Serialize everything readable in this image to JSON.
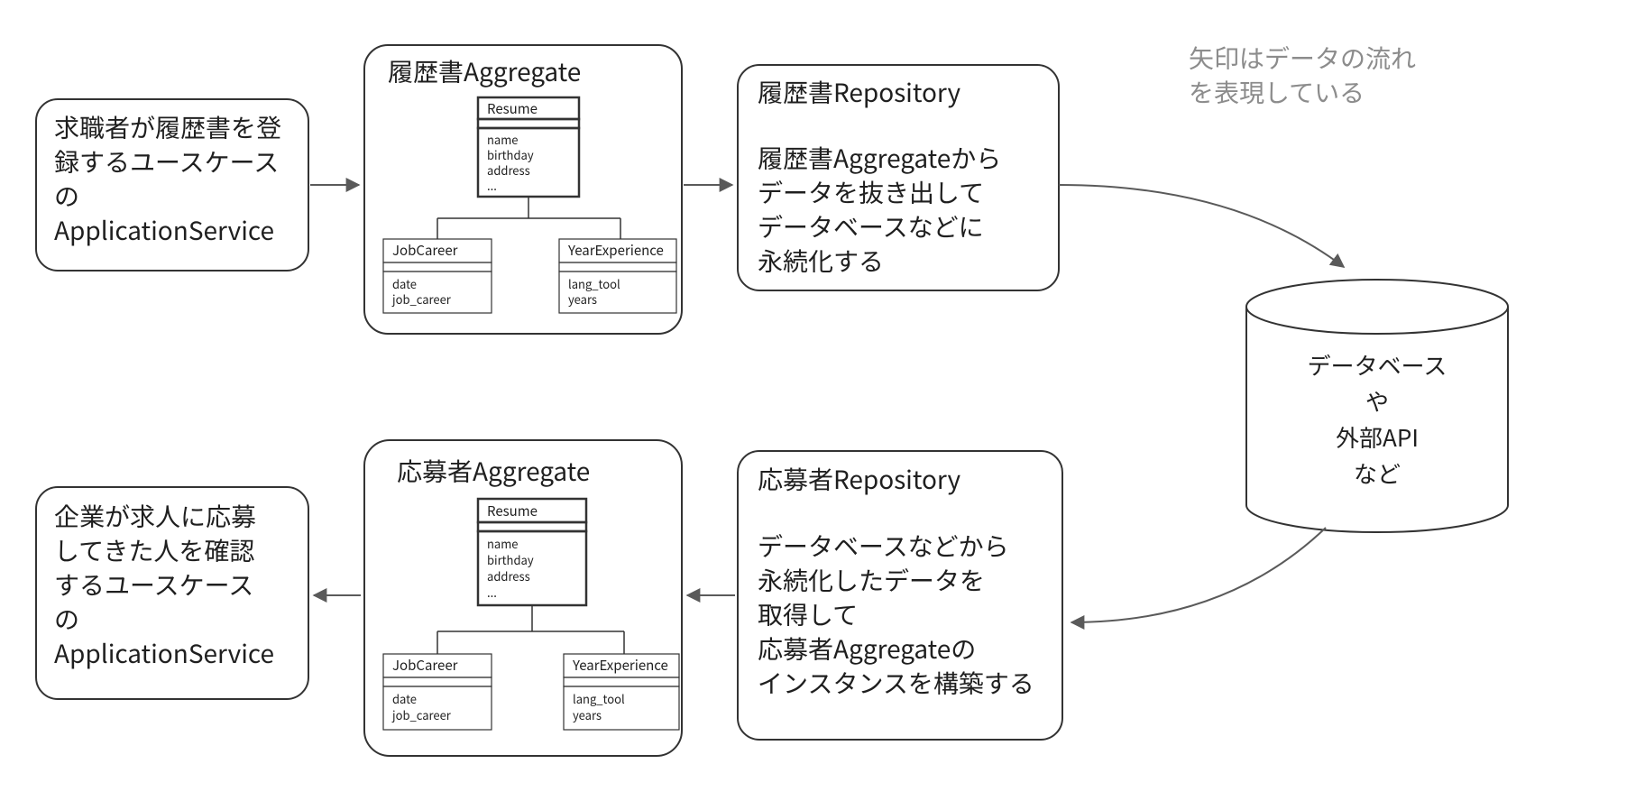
{
  "annotation": {
    "line1": "矢印はデータの流れ",
    "line2": "を表現している"
  },
  "top": {
    "appService": {
      "line1": "求職者が履歴書を登",
      "line2": "録するユースケース",
      "line3": "の",
      "line4": "ApplicationService"
    },
    "aggregate": {
      "title": "履歴書Aggregate",
      "root": {
        "name": "Resume",
        "attr1": "name",
        "attr2": "birthday",
        "attr3": "address",
        "attr4": "..."
      },
      "left": {
        "name": "JobCareer",
        "attr1": "date",
        "attr2": "job_career"
      },
      "right": {
        "name": "YearExperience",
        "attr1": "lang_tool",
        "attr2": "years"
      }
    },
    "repository": {
      "title": "履歴書Repository",
      "line1": "履歴書Aggregateから",
      "line2": "データを抜き出して",
      "line3": "データベースなどに",
      "line4": "永続化する"
    }
  },
  "bottom": {
    "appService": {
      "line1": "企業が求人に応募",
      "line2": "してきた人を確認",
      "line3": "するユースケース",
      "line4": "の",
      "line5": "ApplicationService"
    },
    "aggregate": {
      "title": "応募者Aggregate",
      "root": {
        "name": "Resume",
        "attr1": "name",
        "attr2": "birthday",
        "attr3": "address",
        "attr4": "..."
      },
      "left": {
        "name": "JobCareer",
        "attr1": "date",
        "attr2": "job_career"
      },
      "right": {
        "name": "YearExperience",
        "attr1": "lang_tool",
        "attr2": "years"
      }
    },
    "repository": {
      "title": "応募者Repository",
      "line1": "データベースなどから",
      "line2": "永続化したデータを",
      "line3": "取得して",
      "line4": "応募者Aggregateの",
      "line5": "インスタンスを構築する"
    }
  },
  "db": {
    "line1": "データベース",
    "line2": "や",
    "line3": "外部API",
    "line4": "など"
  }
}
